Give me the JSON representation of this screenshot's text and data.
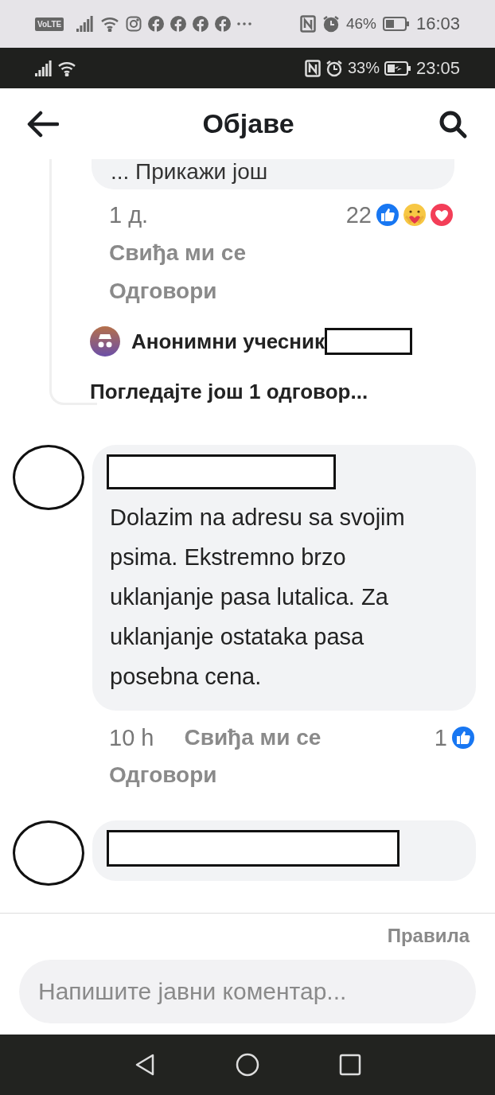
{
  "outer_status_bar": {
    "badge": "VoLTE",
    "battery": "46%",
    "time": "16:03"
  },
  "inner_status_bar": {
    "battery": "33%",
    "time": "23:05"
  },
  "header": {
    "title": "Објаве"
  },
  "thread": {
    "previous_comment": {
      "text_tail": "... Прикажи још",
      "time": "1 д.",
      "reaction_count": "22",
      "reactions": [
        {
          "kind": "like"
        },
        {
          "kind": "care"
        },
        {
          "kind": "love"
        }
      ],
      "like": "Свиђа ми се",
      "reply": "Одговори"
    },
    "reply": {
      "author": "Анонимни учесник"
    },
    "more_replies": "Погледајте још 1 одговор..."
  },
  "comments": [
    {
      "kind": "text",
      "text": "Dolazim na adresu sa svojim psima. Ekstremno brzo uklanjanje pasa lutalica. Za uklanjanje ostataka pasa posebna cena.",
      "time": "10 h",
      "like": "Свиђа ми се",
      "reply": "Одговори",
      "reaction_count": "1",
      "reactions": [
        {
          "kind": "like"
        }
      ]
    },
    {
      "kind": "redacted"
    }
  ],
  "footer": {
    "rules": "Правила",
    "placeholder": "Напишите јавни коментар..."
  }
}
